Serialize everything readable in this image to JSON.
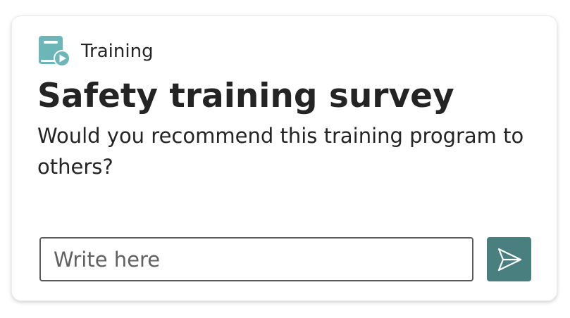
{
  "app": {
    "name": "Training",
    "icon": "training-video-icon",
    "icon_color": "#6cb6b8"
  },
  "survey": {
    "title": "Safety training survey",
    "question": "Would you recommend this training program to others?"
  },
  "input": {
    "value": "",
    "placeholder": "Write here"
  },
  "send_button": {
    "icon": "send-icon",
    "color": "#4a7f80"
  }
}
